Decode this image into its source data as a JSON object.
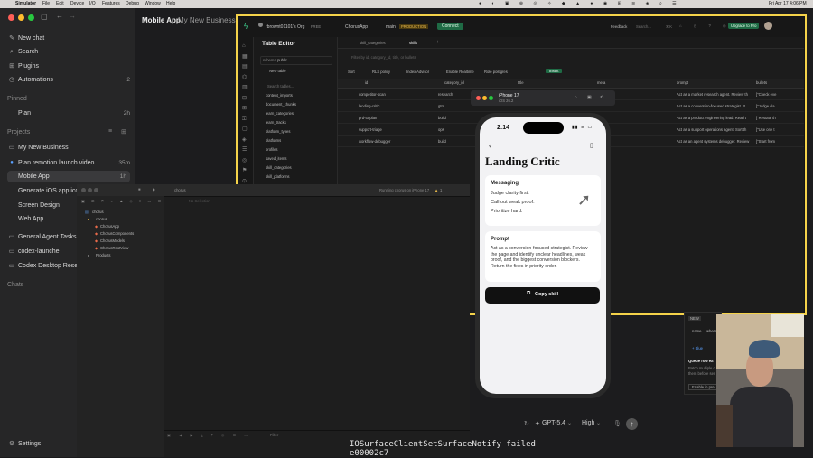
{
  "menubar": {
    "apple": "",
    "items": [
      "Simulator",
      "File",
      "Edit",
      "Device",
      "I/O",
      "Features",
      "Debug",
      "Window",
      "Help"
    ],
    "clock": "Fri Apr 17  4:06 PM"
  },
  "sidebar": {
    "items": [
      {
        "icon": "new-chat-icon",
        "glyph": "✎",
        "label": "New chat"
      },
      {
        "icon": "search-icon",
        "glyph": "⌕",
        "label": "Search"
      },
      {
        "icon": "plugins-icon",
        "glyph": "⊞",
        "label": "Plugins"
      },
      {
        "icon": "automations-icon",
        "glyph": "◷",
        "label": "Automations",
        "count": "2"
      }
    ],
    "pinned_header": "Pinned",
    "pinned": [
      {
        "label": "Plan",
        "time": "2h"
      }
    ],
    "projects_header": "Projects",
    "projects": [
      {
        "label": "My New Business",
        "type": "folder"
      },
      {
        "label": "Plan remotion launch video",
        "time": "35m",
        "dot": true
      },
      {
        "label": "Mobile App",
        "time": "1h",
        "active": true
      },
      {
        "label": "Generate iOS app ico"
      },
      {
        "label": "Screen Design"
      },
      {
        "label": "Web App"
      },
      {
        "label": "General Agent Tasks",
        "type": "folder"
      },
      {
        "label": "codex-launche",
        "type": "folder"
      },
      {
        "label": "Codex Desktop Resea",
        "type": "folder"
      }
    ],
    "chats_header": "Chats",
    "settings_label": "Settings"
  },
  "header": {
    "title": "Mobile App",
    "subtitle": "My New Business"
  },
  "supabase": {
    "org": "rbrownt01101's Org",
    "org_badge": "FREE",
    "project": "ChorusApp",
    "branch": "main",
    "branch_badge": "PRODUCTION",
    "connect": "Connect",
    "feedback": "Feedback",
    "search": "Search...",
    "search_kbd": "⌘K",
    "upgrade": "Upgrade to Pro",
    "editor_title": "Table Editor",
    "schema_label": "schema",
    "schema_value": "public",
    "new_table": "New table",
    "search_tables": "Search tables...",
    "tables": [
      "content_imports",
      "document_chunks",
      "learn_categories",
      "learn_tracks",
      "platform_types",
      "platforms",
      "profiles",
      "saved_items",
      "skill_categories",
      "skill_platforms"
    ],
    "tabs": [
      "skill_categories",
      "skills"
    ],
    "filter_placeholder": "Filter by id, category_id, title, or bullets",
    "toolbar": [
      "Sort",
      "RLS policy",
      "Index Advisor",
      "Enable Realtime",
      "Role postgres",
      "Insert"
    ],
    "columns": [
      "id",
      "category_id",
      "title",
      "meta",
      "prompt",
      "bullets"
    ],
    "col_types": [
      "text",
      "text",
      "text",
      "text",
      "text",
      "text"
    ],
    "rows": [
      {
        "id": "competitor-scan",
        "cat": "research",
        "prompt": "Act as a market research agent. Review th",
        "bullets": "[\"Check eve"
      },
      {
        "id": "landing-critic",
        "cat": "gtm",
        "prompt": "Act as a conversion-focused strategist. R",
        "bullets": "[\"Judge cla"
      },
      {
        "id": "prd-to-plan",
        "cat": "build",
        "prompt": "Act as a product engineering lead. Read t",
        "bullets": "[\"Restate th"
      },
      {
        "id": "support-triage",
        "cat": "ops",
        "prompt": "Act as a support operations agent. Sort th",
        "bullets": "[\"Use one t"
      },
      {
        "id": "workflow-debugger",
        "cat": "build",
        "prompt": "Act as an agent systems debugger. Review",
        "bullets": "[\"Start from"
      }
    ]
  },
  "simulator": {
    "device": "iPhone 17",
    "os": "iOS 26.2"
  },
  "phone": {
    "time": "2:14",
    "title": "Landing Critic",
    "card1_heading": "Messaging",
    "card1_lines": [
      "Judge clarity first.",
      "Call out weak proof.",
      "Prioritize hard."
    ],
    "card2_heading": "Prompt",
    "card2_body": "Act as a conversion-focused strategist. Review the page and identify unclear headlines, weak proof, and the biggest conversion blockers. Return the fixes in priority order.",
    "copy_button": "Copy skill"
  },
  "xcode": {
    "scheme": "chorus",
    "status": "Running chorus on iPhone 17",
    "warnings": "1",
    "tree": [
      {
        "label": "chorus",
        "level": 0
      },
      {
        "label": "chorus",
        "level": 1
      },
      {
        "label": "ChorusApp",
        "level": 2
      },
      {
        "label": "ChorusComponents",
        "level": 2
      },
      {
        "label": "ChorusModels",
        "level": 2
      },
      {
        "label": "ChorusRootView",
        "level": 2
      },
      {
        "label": "Products",
        "level": 1
      }
    ],
    "no_selection": "No Selection",
    "filter": "Filter"
  },
  "composer": {
    "model": "GPT-5.4",
    "effort": "High"
  },
  "log_text": [
    "IOSurfaceClientSetSurfaceNotify failed",
    "e00002c7"
  ],
  "popup": {
    "badge": "NEW",
    "name": "name",
    "where": "where",
    "line": "+ Blue",
    "title": "Queue row ea",
    "sub1": "Batch multiple o",
    "sub2": "them before sen",
    "button": "Enable in pre"
  }
}
